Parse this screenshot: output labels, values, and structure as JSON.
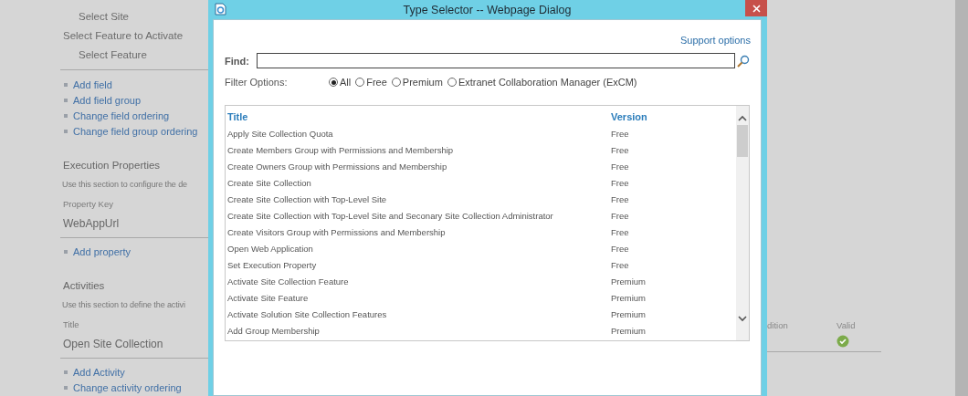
{
  "background_page": {
    "items": [
      {
        "kind": "substep",
        "text": "Select Site"
      },
      {
        "kind": "step",
        "text": "Select Feature to Activate"
      },
      {
        "kind": "substep",
        "text": "Select Feature"
      },
      {
        "kind": "rule"
      },
      {
        "kind": "link",
        "text": "Add field"
      },
      {
        "kind": "link",
        "text": "Add field group"
      },
      {
        "kind": "link",
        "text": "Change field ordering"
      },
      {
        "kind": "link",
        "text": "Change field group ordering"
      },
      {
        "kind": "section_title",
        "text": "Execution Properties"
      },
      {
        "kind": "description",
        "text": "Use this section to configure the de"
      },
      {
        "kind": "field_label",
        "text": "Property Key"
      },
      {
        "kind": "field_value",
        "text": "WebAppUrl"
      },
      {
        "kind": "rule"
      },
      {
        "kind": "link",
        "text": "Add property"
      },
      {
        "kind": "section_title",
        "text": "Activities"
      },
      {
        "kind": "description",
        "text": "Use this section to define the activi"
      },
      {
        "kind": "field_label",
        "text": "Title"
      },
      {
        "kind": "field_value",
        "text": "Open Site Collection"
      },
      {
        "kind": "rule"
      },
      {
        "kind": "link",
        "text": "Add Activity"
      },
      {
        "kind": "link",
        "text": "Change activity ordering"
      }
    ],
    "right_columns": [
      "dition",
      "Valid"
    ],
    "activity_row": {
      "valid": true
    }
  },
  "dialog": {
    "title": "Type Selector -- Webpage Dialog",
    "support_link": "Support options",
    "find": {
      "label": "Find:"
    },
    "filter": {
      "label": "Filter Options:",
      "options": [
        {
          "label": "All",
          "selected": true
        },
        {
          "label": "Free",
          "selected": false
        },
        {
          "label": "Premium",
          "selected": false
        },
        {
          "label": "Extranet Collaboration Manager (ExCM)",
          "selected": false
        }
      ]
    },
    "table": {
      "columns": [
        "Title",
        "Version"
      ],
      "rows": [
        {
          "title": "Apply Site Collection Quota",
          "version": "Free"
        },
        {
          "title": "Create Members Group with Permissions and Membership",
          "version": "Free"
        },
        {
          "title": "Create Owners Group with Permissions and Membership",
          "version": "Free"
        },
        {
          "title": "Create Site Collection",
          "version": "Free"
        },
        {
          "title": "Create Site Collection with Top-Level Site",
          "version": "Free"
        },
        {
          "title": "Create Site Collection with Top-Level Site and Seconary Site Collection Administrator",
          "version": "Free"
        },
        {
          "title": "Create Visitors Group with Permissions and Membership",
          "version": "Free"
        },
        {
          "title": "Open Web Application",
          "version": "Free"
        },
        {
          "title": "Set Execution Property",
          "version": "Free"
        },
        {
          "title": "Activate Site Collection Feature",
          "version": "Premium"
        },
        {
          "title": "Activate Site Feature",
          "version": "Premium"
        },
        {
          "title": "Activate Solution Site Collection Features",
          "version": "Premium"
        },
        {
          "title": "Add Group Membership",
          "version": "Premium"
        }
      ]
    }
  }
}
